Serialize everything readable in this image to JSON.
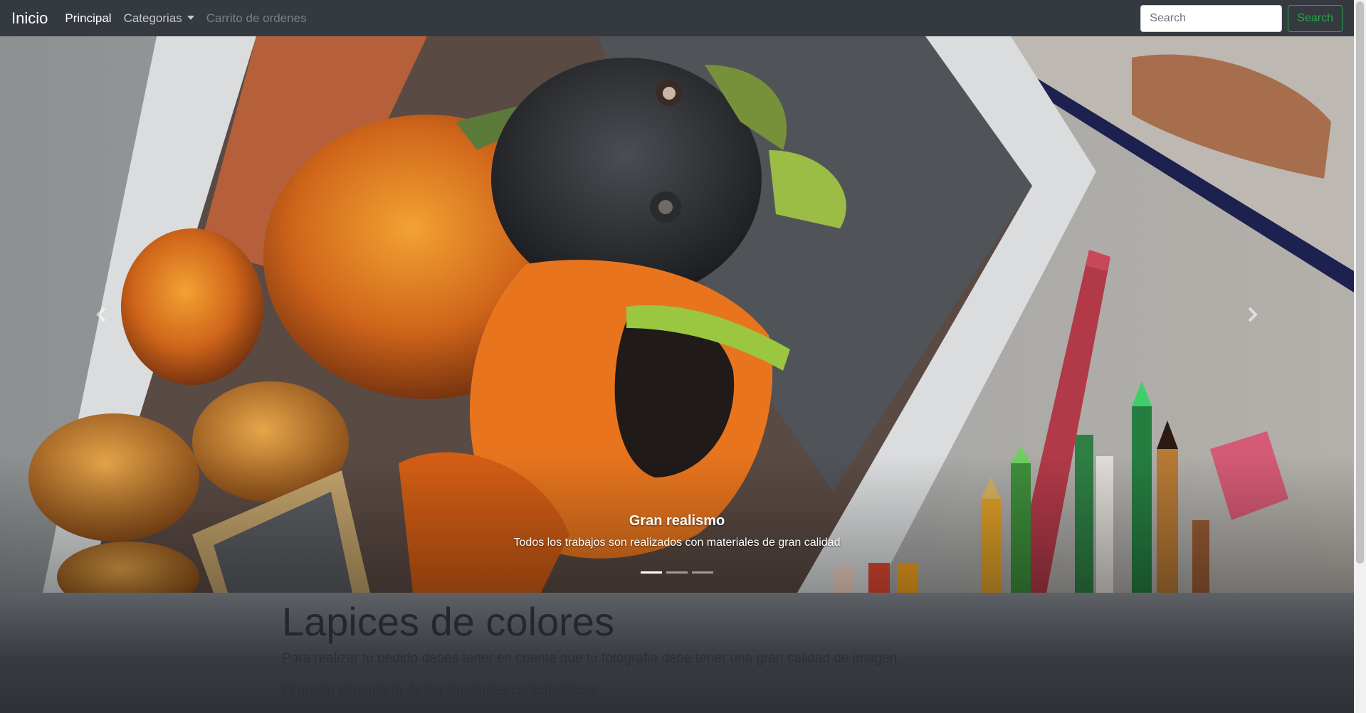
{
  "navbar": {
    "brand": "Inicio",
    "links": [
      {
        "label": "Principal",
        "state": "active"
      },
      {
        "label": "Categorias",
        "state": "dropdown"
      },
      {
        "label": "Carrito de ordenes",
        "state": "disabled"
      }
    ],
    "search": {
      "placeholder": "Search",
      "button_label": "Search"
    }
  },
  "carousel": {
    "slide": {
      "caption_title": "Gran realismo",
      "caption_text": "Todos los trabajos son realizados con materiales de gran calidad"
    },
    "indicator_count": 3,
    "active_indicator": 0,
    "icons": {
      "prev": "chevron-left-icon",
      "next": "chevron-right-icon"
    }
  },
  "main": {
    "title": "Lapices de colores",
    "paragraph_1": "Para realizar tu pedido debes tener en cuenta que tu fotografia debe tener una gran calidad de imagen.",
    "paragraph_2": "El precio dependerá de las siguientes características."
  },
  "colors": {
    "navbar_bg": "#343a40",
    "search_accent": "#28a745"
  }
}
